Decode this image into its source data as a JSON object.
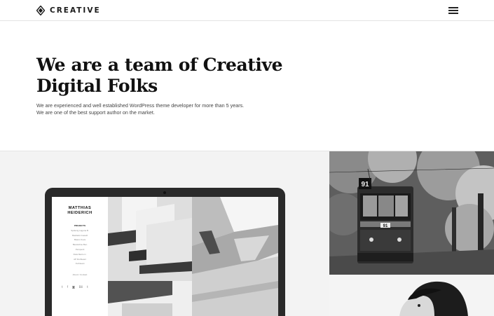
{
  "header": {
    "brand": "CREATIVE",
    "logo_icon": "diamond-logo-icon",
    "menu_icon": "hamburger-menu-icon"
  },
  "hero": {
    "title_line1": "We are a team of Creative",
    "title_line2": "Digital Folks",
    "description_line1": "We are experienced and well established WordPress theme developer for more than 5 years.",
    "description_line2": "We are one of the best support author on the market."
  },
  "laptop_site": {
    "name_line1": "MATTHIAS",
    "name_line2": "HEIDERICH",
    "menu": [
      "PROJECTS",
      "Spiderig Laguna B.",
      "Madrado Guesdt",
      "Basco Kuva",
      "Biestrahne Ben",
      "Perspecti",
      "Klais Metro C.",
      "AP Rurbleant",
      "Xurbleant"
    ],
    "contact": "About / Contact",
    "social_icons": [
      "twitter-icon",
      "facebook-icon",
      "instagram-icon",
      "behance-icon",
      "tumblr-icon"
    ]
  },
  "gallery": {
    "tram_sign": "91",
    "tram_plate": "91"
  },
  "colors": {
    "text": "#111111",
    "muted": "#444444",
    "panel_bg": "#f3f3f3",
    "laptop": "#2a2a2a"
  }
}
